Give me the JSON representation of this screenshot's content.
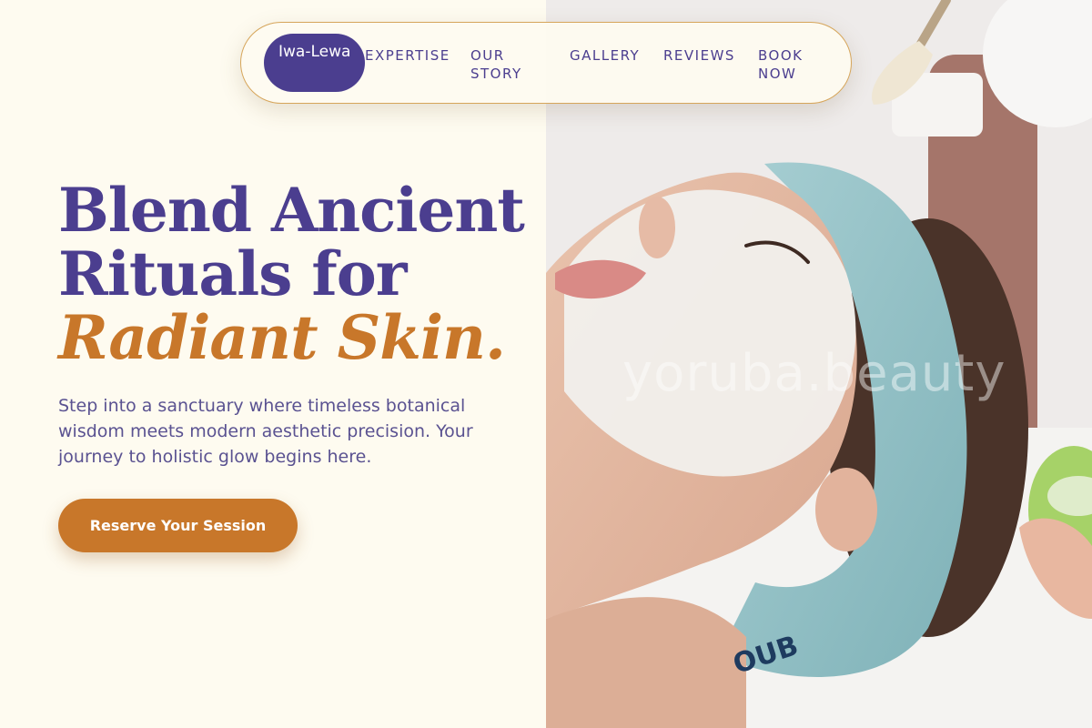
{
  "brand": {
    "name": "Iwa-Lewa"
  },
  "nav": {
    "links": [
      "EXPERTISE",
      "OUR STORY",
      "GALLERY",
      "REVIEWS",
      "BOOK NOW"
    ]
  },
  "hero": {
    "headline_line1": "Blend Ancient",
    "headline_line2": "Rituals for",
    "headline_accent": "Radiant Skin.",
    "lede": "Step into a sanctuary where timeless botanical wisdom meets modern aesthetic precision. Your journey to holistic glow begins here.",
    "cta_label": "Reserve Your Session"
  },
  "photo": {
    "watermark": "yoruba.beauty",
    "headband_text": "OUB"
  },
  "colors": {
    "background": "#fefbf0",
    "primary": "#4b3e8f",
    "accent": "#c8772a",
    "nav_border": "#d6a55a"
  }
}
